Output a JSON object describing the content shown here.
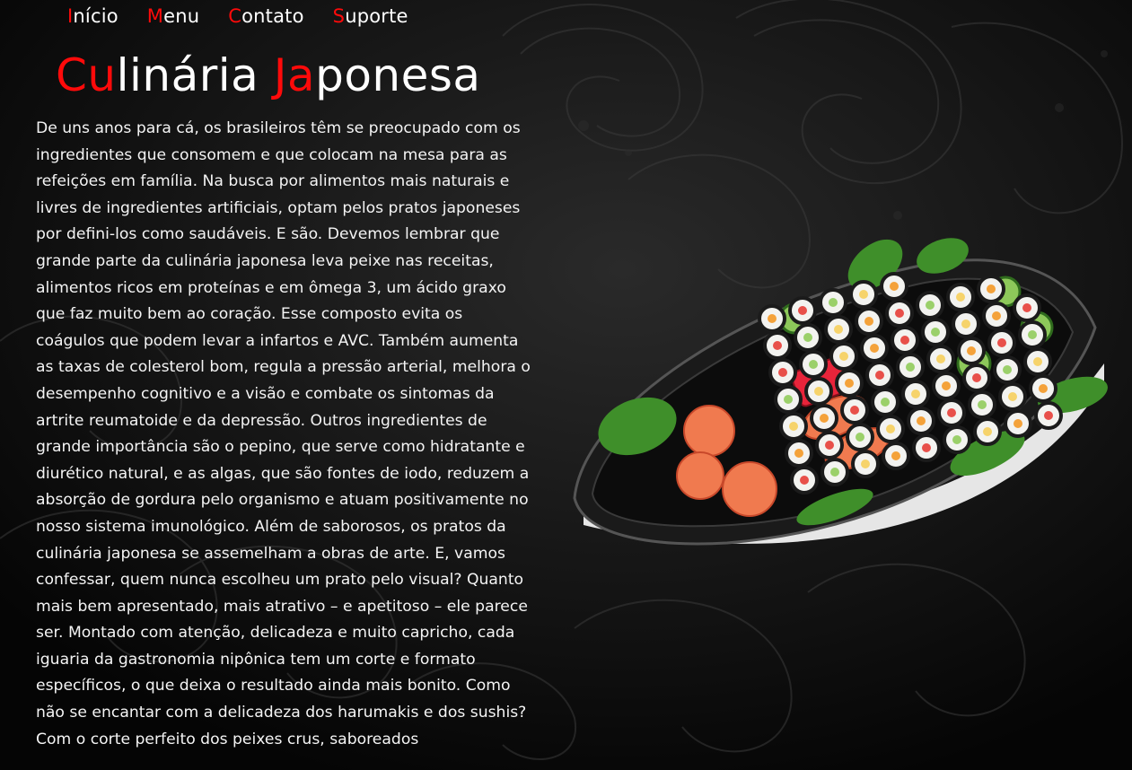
{
  "nav": {
    "items": [
      {
        "first": "I",
        "rest": "nício"
      },
      {
        "first": "M",
        "rest": "enu"
      },
      {
        "first": "C",
        "rest": "ontato"
      },
      {
        "first": "S",
        "rest": "uporte"
      }
    ]
  },
  "title": {
    "part1_red": "Cu",
    "part1_white": "linária ",
    "part2_red": "Ja",
    "part2_white": "ponesa"
  },
  "article": {
    "text": "De uns anos para cá, os brasileiros têm se preocupado com os ingredientes que consomem e que colocam na mesa para as refeições em família. Na busca por alimentos mais naturais e livres de ingredientes artificiais, optam pelos pratos japoneses por defini-los como saudáveis. E são. Devemos lembrar que grande parte da culinária japonesa leva peixe nas receitas, alimentos ricos em proteínas e em ômega 3, um ácido graxo que faz muito bem ao coração. Esse composto evita os coágulos que podem levar a infartos e AVC. Também aumenta as taxas de colesterol bom, regula a pressão arterial, melhora o desempenho cognitivo e a visão e combate os sintomas da artrite reumatoide e da depressão. Outros ingredientes de grande importância são o pepino, que serve como hidratante e diurético natural, e as algas, que são fontes de iodo, reduzem a absorção de gordura pelo organismo e atuam positivamente no nosso sistema imunológico. Além de saborosos, os pratos da culinária japonesa se assemelham a obras de arte. E, vamos confessar, quem nunca escolheu um prato pelo visual? Quanto mais bem apresentado, mais atrativo – e apetitoso – ele parece ser. Montado com atenção, delicadeza e muito capricho, cada iguaria da gastronomia nipônica tem um corte e formato específicos, o que deixa o resultado ainda mais bonito. Como não se encantar com a delicadeza dos harumakis e dos sushis? Com o corte perfeito dos peixes crus, saboreados"
  },
  "colors": {
    "accent": "#ff0a0a",
    "background": "#000000",
    "text": "#ffffff"
  }
}
